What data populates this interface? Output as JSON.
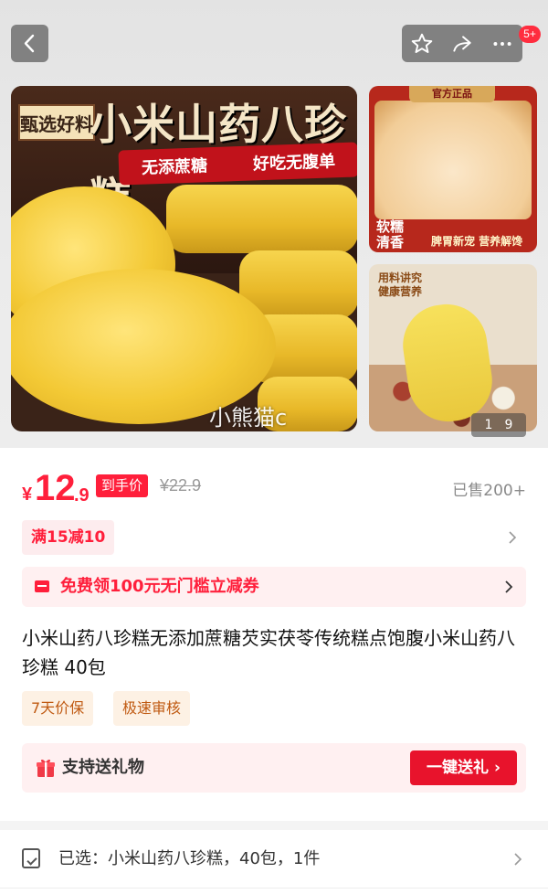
{
  "topbar": {
    "back_icon": "chevron-left-icon",
    "favorite_icon": "star-icon",
    "share_icon": "share-icon",
    "more_icon": "more-icon",
    "badge": "5+"
  },
  "gallery": {
    "main_image": {
      "tag": "甄选好料",
      "headline": "小米山药八珍糕",
      "slogan_1": "无添蔗糖",
      "slogan_2": "好吃无腹单",
      "watermark": "小熊猫c"
    },
    "thumb1": {
      "ribbon": "官方正品",
      "label_1a": "软糯",
      "label_1b": "清香",
      "label_2": "脾胃新宠 营养解馋"
    },
    "thumb2": {
      "text_1": "用料讲究",
      "text_2": "健康营养"
    },
    "counter": {
      "current": "1",
      "total": "9"
    }
  },
  "price": {
    "currency": "¥",
    "integer": "12",
    "decimal": ".9",
    "label": "到手价",
    "original": "¥22.9",
    "sold": "已售200+"
  },
  "promotion": {
    "tag": "满15减10"
  },
  "coupon": {
    "text": "免费领100元无门槛立减券"
  },
  "product": {
    "title": "小米山药八珍糕无添加蔗糖芡实茯苓传统糕点饱腹小米山药八珍糕 40包"
  },
  "guarantees": [
    "7天价保",
    "极速审核"
  ],
  "gift": {
    "text": "支持送礼物",
    "button": "一键送礼"
  },
  "selection": {
    "text": "已选：小米山药八珍糕，40包，1件"
  },
  "colors": {
    "accent": "#ff1f3b",
    "gift_button": "#e8132c",
    "guarantee_text": "#c05a12"
  }
}
